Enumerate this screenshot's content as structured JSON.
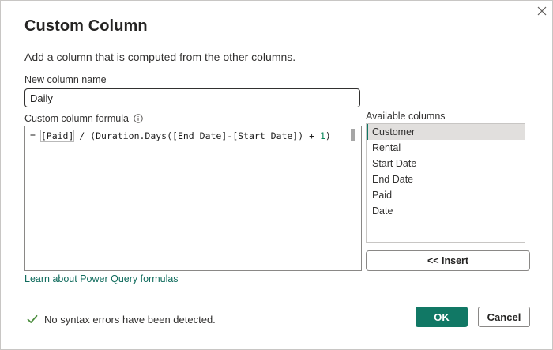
{
  "dialog": {
    "title": "Custom Column",
    "subtitle": "Add a column that is computed from the other columns.",
    "close_icon": "close-icon"
  },
  "new_column": {
    "label": "New column name",
    "value": "Daily"
  },
  "formula": {
    "label": "Custom column formula",
    "info_icon": "info-icon",
    "code_prefix": "= ",
    "code_bracket": "[Paid]",
    "code_middle": " / (Duration.Days([End Date]-[Start Date]) + ",
    "code_number": "1",
    "code_suffix": ")"
  },
  "learn_link": "Learn about Power Query formulas",
  "available": {
    "label": "Available columns",
    "items": [
      "Customer",
      "Rental",
      "Start Date",
      "End Date",
      "Paid",
      "Date"
    ],
    "selected": "Customer"
  },
  "insert_label": "<< Insert",
  "status": {
    "text": "No syntax errors have been detected.",
    "icon": "checkmark-icon",
    "color": "#4a8c3c"
  },
  "buttons": {
    "ok": "OK",
    "cancel": "Cancel"
  },
  "colors": {
    "accent": "#117865",
    "link": "#0f6b5c"
  }
}
